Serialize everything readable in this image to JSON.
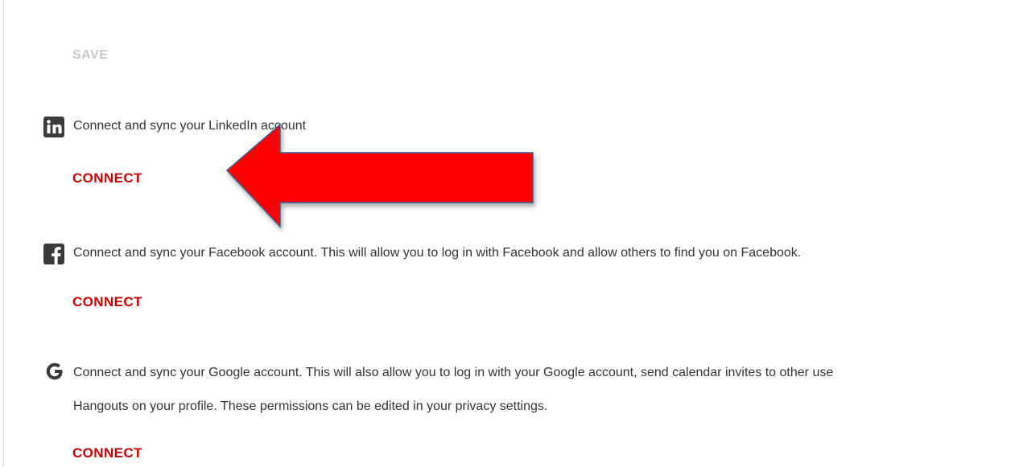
{
  "save_label": "SAVE",
  "accent_color": "#cc0000",
  "integrations": [
    {
      "icon": "linkedin-icon",
      "description": "Connect and sync your LinkedIn account",
      "connect_label": "CONNECT"
    },
    {
      "icon": "facebook-icon",
      "description": "Connect and sync your Facebook account. This will allow you to log in with Facebook and allow others to find you on Facebook.",
      "connect_label": "CONNECT"
    },
    {
      "icon": "google-icon",
      "description_line1": "Connect and sync your Google account. This will also allow you to log in with your Google account, send calendar invites to other use",
      "description_line2": "Hangouts on your profile. These permissions can be edited in your privacy settings.",
      "connect_label": "CONNECT"
    }
  ],
  "annotation": {
    "type": "red-arrow-pointing-left",
    "color": "#ff0000"
  }
}
